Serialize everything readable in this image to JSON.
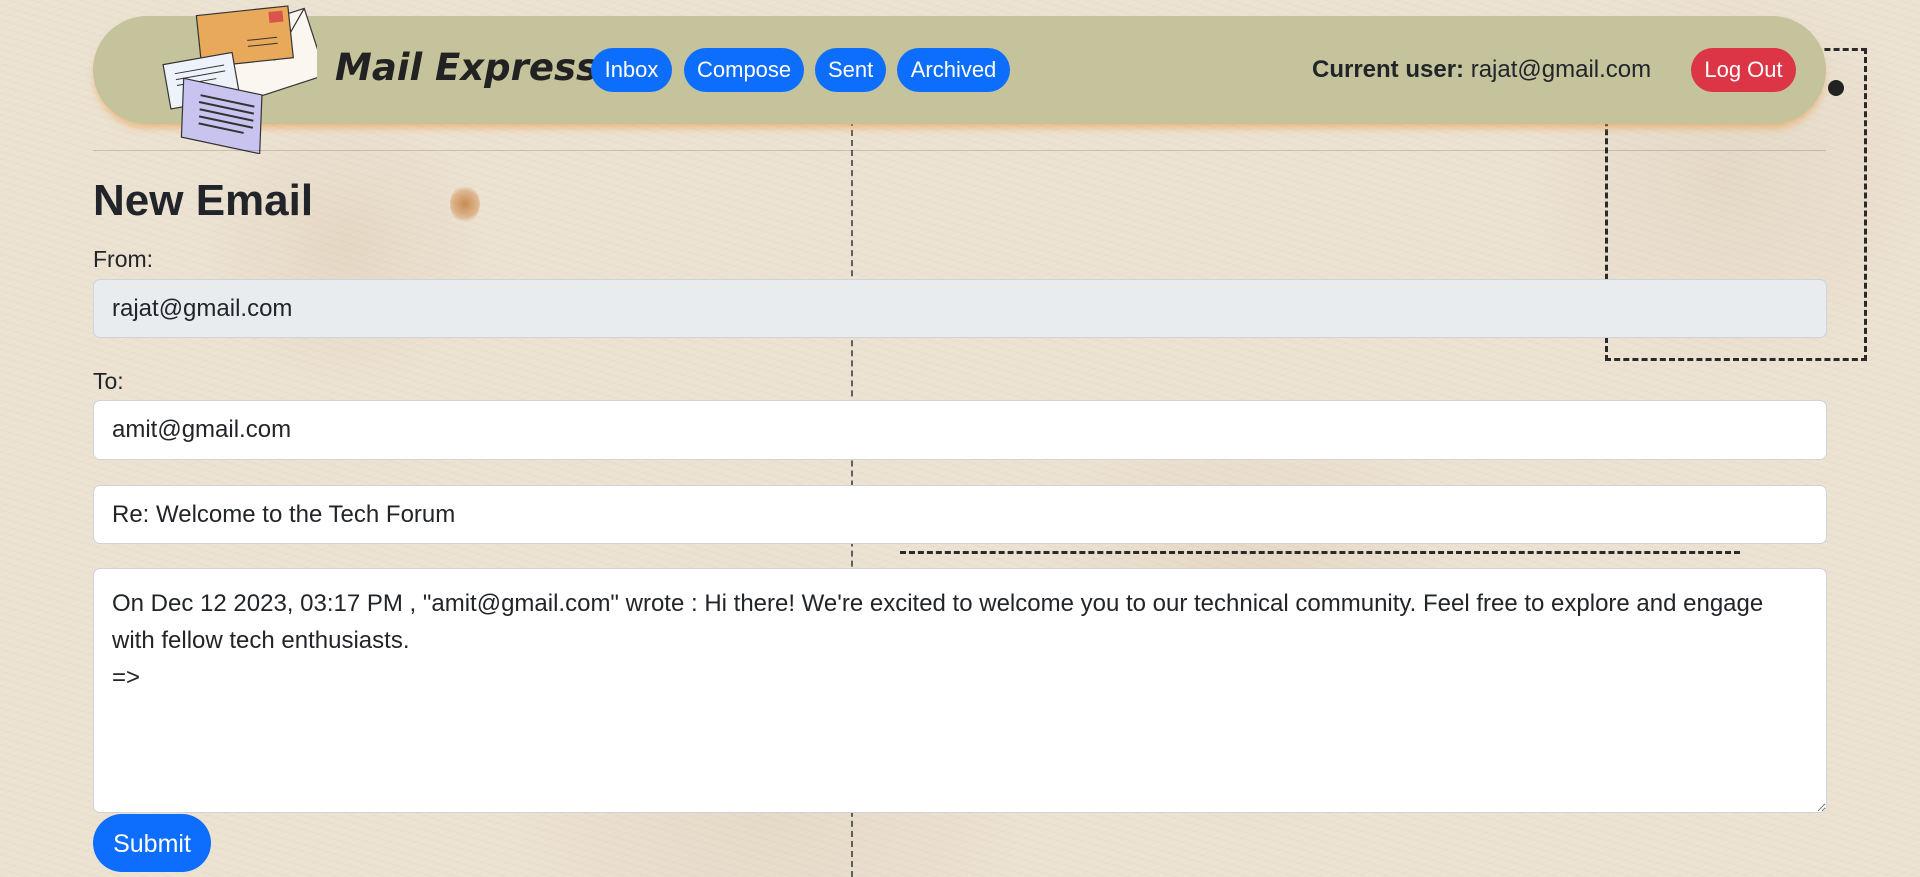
{
  "header": {
    "brand": "Mail Express",
    "nav": {
      "inbox": "Inbox",
      "compose": "Compose",
      "sent": "Sent",
      "archived": "Archived"
    },
    "current_user_label": "Current user:",
    "current_user_value": "rajat@gmail.com",
    "logout": "Log Out",
    "logo_icon": "envelopes-logo-icon"
  },
  "compose": {
    "title": "New Email",
    "from_label": "From:",
    "from_value": "rajat@gmail.com",
    "to_label": "To:",
    "to_value": "amit@gmail.com",
    "subject_value": "Re: Welcome to the Tech Forum",
    "body_value": "On Dec 12 2023, 03:17 PM , \"amit@gmail.com\" wrote : Hi there! We're excited to welcome you to our technical community. Feel free to explore and engage with fellow tech enthusiasts.\n=>",
    "submit": "Submit"
  },
  "colors": {
    "primary": "#0d6efd",
    "danger": "#dc3545",
    "navbar": "#c4c39b",
    "readonly_field": "#e9ecef"
  }
}
